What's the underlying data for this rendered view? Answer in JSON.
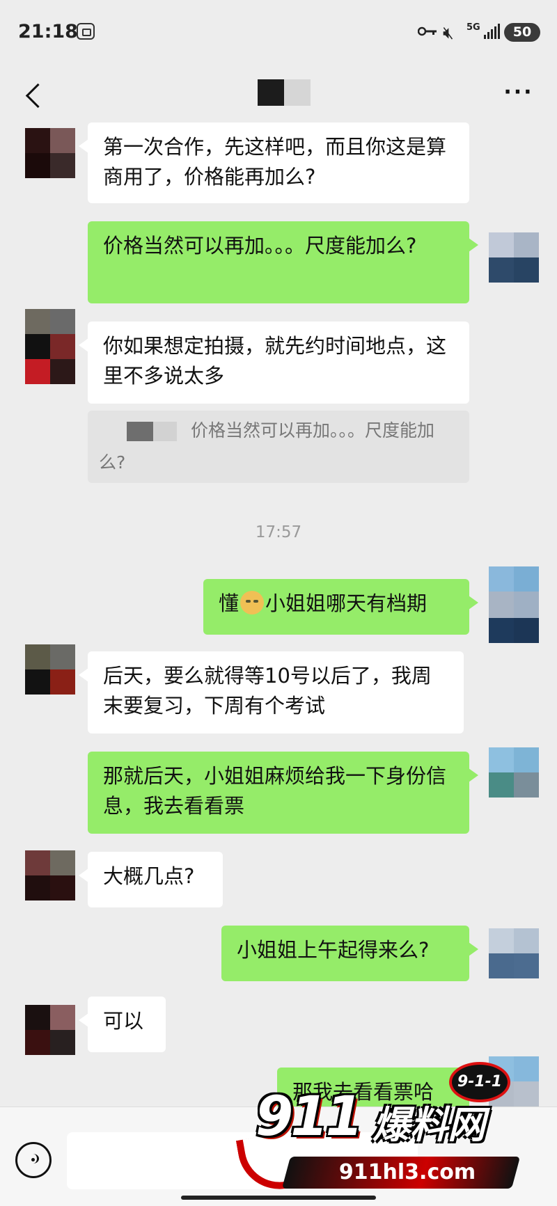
{
  "status_bar": {
    "time": "21:18",
    "network": "5G",
    "battery": "50"
  },
  "header": {
    "back_icon": "chevron-left-icon",
    "more_icon": "ellipsis-icon",
    "more_label": "···"
  },
  "messages": [
    {
      "side": "in",
      "text": "第一次合作，先这样吧，而且你这是算商用了，价格能再加么?"
    },
    {
      "side": "out",
      "text": "价格当然可以再加。。。尺度能加么?"
    },
    {
      "side": "in",
      "text": "你如果想定拍摄，就先约时间地点，这里不多说太多"
    },
    {
      "side": "quote",
      "text": "价格当然可以再加。。。尺度能加么?"
    },
    {
      "side": "time",
      "text": "17:57"
    },
    {
      "side": "out",
      "text_before": "懂",
      "emoji": "doge-emoji",
      "text_after": "小姐姐哪天有档期"
    },
    {
      "side": "in",
      "text": "后天，要么就得等10号以后了，我周末要复习，下周有个考试"
    },
    {
      "side": "out",
      "text": "那就后天，小姐姐麻烦给我一下身份信息，我去看看票"
    },
    {
      "side": "in",
      "text": "大概几点?"
    },
    {
      "side": "out",
      "text": "小姐姐上午起得来么?"
    },
    {
      "side": "in",
      "text": "可以"
    },
    {
      "side": "out",
      "text": "那我去看看票哈"
    }
  ],
  "input_bar": {
    "voice_icon": "voice-icon",
    "placeholder": ""
  },
  "watermark": {
    "number": "911",
    "name": "爆料网",
    "badge": "9-1-1",
    "url": "911hl3.com"
  },
  "colors": {
    "background": "#ededed",
    "incoming_bubble": "#ffffff",
    "outgoing_bubble": "#95ec69",
    "quote_bg": "#e3e3e3"
  }
}
